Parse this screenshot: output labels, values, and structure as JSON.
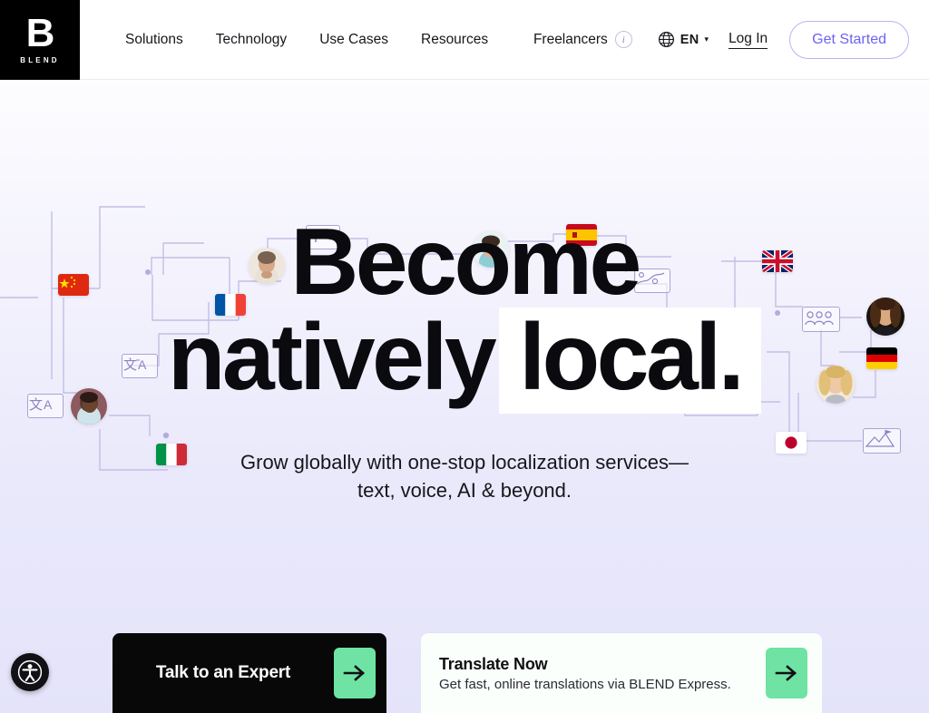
{
  "brand": {
    "logo_letter": "B",
    "logo_wordmark": "BLEND",
    "accent_purple": "#6c63f0",
    "accent_green": "#6fe3a3",
    "logo_green": "#55dd93",
    "dark": "#080808",
    "hero_bg_top": "#fdfdff",
    "hero_bg_bottom": "#e4e3fa"
  },
  "header": {
    "nav_items": [
      {
        "label": "Solutions",
        "name": "nav-item-solutions"
      },
      {
        "label": "Technology",
        "name": "nav-item-technology"
      },
      {
        "label": "Use Cases",
        "name": "nav-item-use-cases"
      },
      {
        "label": "Resources",
        "name": "nav-item-resources"
      }
    ],
    "freelancers_label": "Freelancers",
    "freelancers_info_glyph": "i",
    "language_code": "EN",
    "language_caret": "▾",
    "login_label": "Log In",
    "get_started_label": "Get Started"
  },
  "hero": {
    "headline_line1": "Become",
    "headline_line2_plain": "natively",
    "headline_line2_highlight": "local.",
    "subtitle_line1": "Grow globally with one-stop localization services—",
    "subtitle_line2": "text, voice, AI & beyond."
  },
  "cta": {
    "primary_label": "Talk to an Expert",
    "primary_arrow": "arrow-right-icon",
    "secondary_title": "Translate Now",
    "secondary_subtitle": "Get fast, online translations via BLEND Express.",
    "secondary_arrow": "arrow-right-icon"
  },
  "accessibility": {
    "widget_name": "accessibility-icon"
  },
  "decorations": {
    "blend_badge_letter": "B",
    "flags": [
      {
        "name": "flag-china",
        "label": "China"
      },
      {
        "name": "flag-france",
        "label": "France"
      },
      {
        "name": "flag-italy",
        "label": "Italy"
      },
      {
        "name": "flag-spain",
        "label": "Spain"
      },
      {
        "name": "flag-uk",
        "label": "United Kingdom"
      },
      {
        "name": "flag-germany",
        "label": "Germany"
      },
      {
        "name": "flag-japan",
        "label": "Japan"
      }
    ],
    "icons": [
      {
        "name": "translate-icon",
        "glyph": "文A"
      },
      {
        "name": "text-ai-icon",
        "glyph": "T✦"
      },
      {
        "name": "map-icon",
        "glyph": "map"
      },
      {
        "name": "group-icon",
        "glyph": "group"
      },
      {
        "name": "summit-flag-icon",
        "glyph": "summit"
      }
    ]
  }
}
